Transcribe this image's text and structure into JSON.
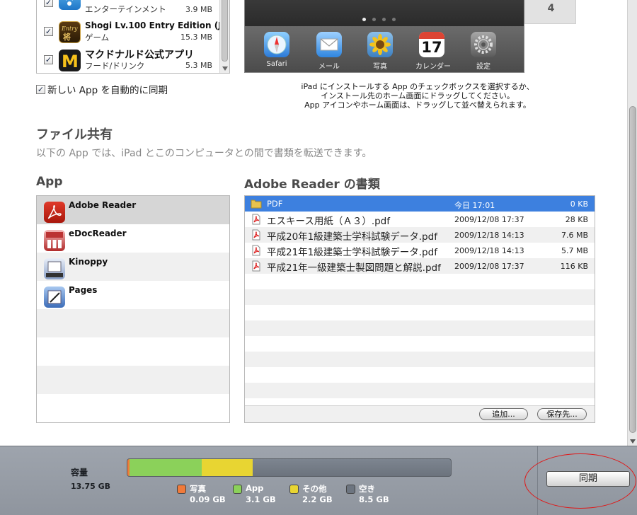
{
  "install_apps": {
    "rows": [
      {
        "name": "",
        "category": "エンターテインメント",
        "size": "3.9 MB",
        "checked": true,
        "icon": "podcast-radio-icon"
      },
      {
        "name": "Shogi Lv.100 Entry Edition (J...",
        "category": "ゲーム",
        "size": "15.3 MB",
        "checked": true,
        "icon": "shogi-icon"
      },
      {
        "name": "マクドナルド公式アプリ",
        "category": "フード/ドリンク",
        "size": "5.3 MB",
        "checked": true,
        "icon": "mcdonalds-icon"
      }
    ]
  },
  "auto_sync": {
    "label": "新しい App を自動的に同期",
    "checked": true
  },
  "home_screen": {
    "page_number": "4",
    "dock": [
      {
        "label": "Safari",
        "icon": "safari-icon"
      },
      {
        "label": "メール",
        "icon": "mail-icon"
      },
      {
        "label": "写真",
        "icon": "photos-icon"
      },
      {
        "label": "カレンダー",
        "icon": "calendar-icon",
        "day": "17"
      },
      {
        "label": "設定",
        "icon": "settings-icon"
      }
    ]
  },
  "install_help": [
    "iPad にインストールする App のチェックボックスを選択するか、",
    "インストール先のホーム画面にドラッグしてください。",
    "App アイコンやホーム画面は、ドラッグして並べ替えられます。"
  ],
  "file_sharing": {
    "title": "ファイル共有",
    "description": "以下の App では、iPad とこのコンピュータとの間で書類を転送できます。",
    "apps_header": "App",
    "apps": [
      {
        "name": "Adobe Reader",
        "icon": "adobe-reader-icon",
        "selected": true
      },
      {
        "name": "eDocReader",
        "icon": "edocreader-icon"
      },
      {
        "name": "Kinoppy",
        "icon": "kinoppy-icon"
      },
      {
        "name": "Pages",
        "icon": "pages-icon"
      }
    ],
    "docs_header": "Adobe Reader の書類",
    "docs": [
      {
        "name": "PDF",
        "date": "今日 17:01",
        "size": "0 KB",
        "type": "folder",
        "selected": true
      },
      {
        "name": "エスキース用紙（Ａ３）.pdf",
        "date": "2009/12/08 17:37",
        "size": "28 KB",
        "type": "pdf"
      },
      {
        "name": "平成20年1級建築士学科試験データ.pdf",
        "date": "2009/12/18 14:13",
        "size": "7.6 MB",
        "type": "pdf"
      },
      {
        "name": "平成21年1級建築士学科試験データ.pdf",
        "date": "2009/12/18 14:13",
        "size": "5.7 MB",
        "type": "pdf"
      },
      {
        "name": "平成21年一級建築士製図問題と解説.pdf",
        "date": "2009/12/08 17:37",
        "size": "116 KB",
        "type": "pdf"
      }
    ],
    "add_button": "追加...",
    "save_button": "保存先..."
  },
  "capacity": {
    "label": "容量",
    "total": "13.75 GB",
    "segments": [
      {
        "name": "写真",
        "value": "0.09 GB",
        "gb": 0.09,
        "color": "#f07a3a"
      },
      {
        "name": "App",
        "value": "3.1 GB",
        "gb": 3.1,
        "color": "#8bd15a"
      },
      {
        "name": "その他",
        "value": "2.2 GB",
        "gb": 2.2,
        "color": "#e8d532"
      },
      {
        "name": "空き",
        "value": "8.5 GB",
        "gb": 8.5,
        "color": "#6d7580"
      }
    ]
  },
  "sync_button": "同期"
}
